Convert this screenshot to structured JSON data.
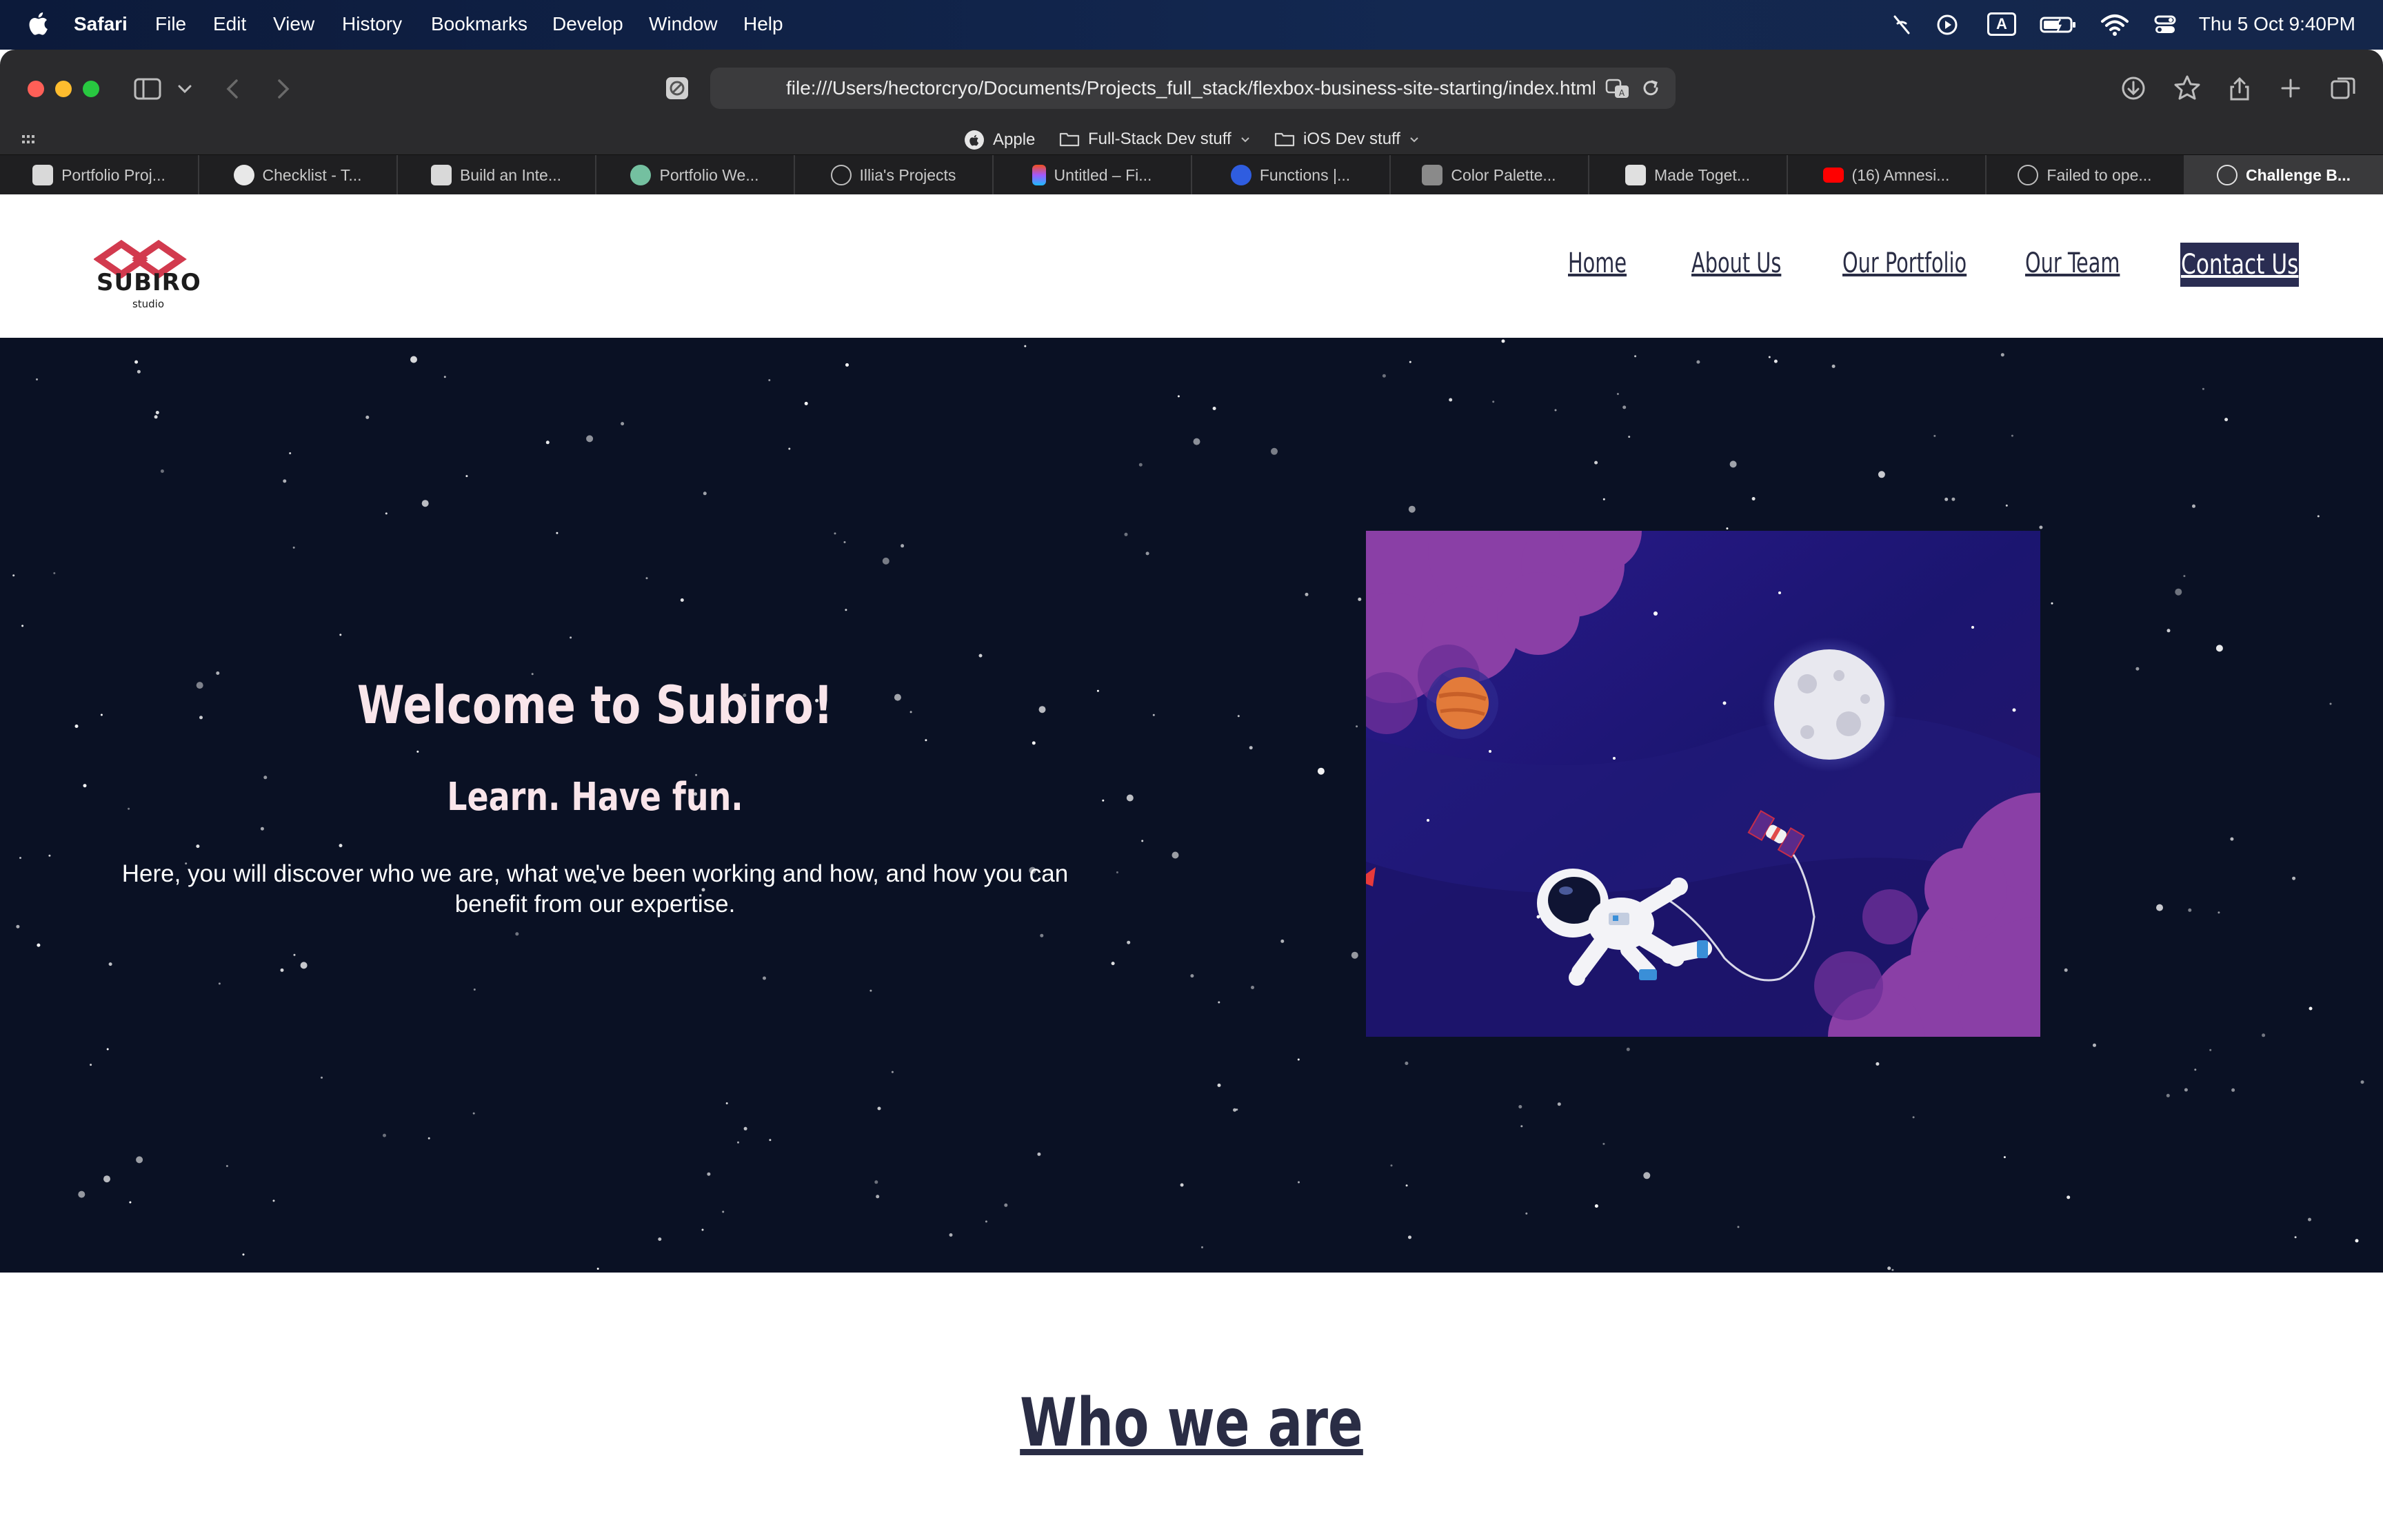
{
  "menubar": {
    "app_name": "Safari",
    "menus": [
      "File",
      "Edit",
      "View",
      "History",
      "Bookmarks",
      "Develop",
      "Window",
      "Help"
    ],
    "status_icons": [
      "wifi-off-icon",
      "play-circle-icon",
      "input-source-a-icon",
      "battery-charging-icon",
      "wifi-icon",
      "control-center-icon"
    ],
    "input_source_label": "A",
    "clock": "Thu 5 Oct  9:40PM"
  },
  "browser": {
    "url": "file:///Users/hectorcryo/Documents/Projects_full_stack/flexbox-business-site-starting/index.html",
    "favorites": [
      {
        "label": "Apple",
        "icon": "apple-icon"
      },
      {
        "label": "Full-Stack Dev stuff",
        "icon": "folder-icon"
      },
      {
        "label": "iOS Dev stuff",
        "icon": "folder-icon"
      }
    ],
    "tabs": [
      {
        "label": "Portfolio Proj...",
        "icon_color": "#d9d9d9",
        "active": false
      },
      {
        "label": "Checklist - T...",
        "icon_color": "#e8e8e8",
        "active": false
      },
      {
        "label": "Build an Inte...",
        "icon_color": "#d9d9d9",
        "active": false
      },
      {
        "label": "Portfolio We...",
        "icon_color": "#74c0a0",
        "active": false
      },
      {
        "label": "Illia's Projects",
        "icon_color": "#bdbdbd",
        "active": false
      },
      {
        "label": "Untitled – Fi...",
        "icon_color": "#f24e1e",
        "active": false
      },
      {
        "label": "Functions |...",
        "icon_color": "#2f5de0",
        "active": false
      },
      {
        "label": "Color Palette...",
        "icon_color": "#8a8a8a",
        "active": false
      },
      {
        "label": "Made Toget...",
        "icon_color": "#e0e0e0",
        "active": false
      },
      {
        "label": "(16) Amnesi...",
        "icon_color": "#ff0000",
        "active": false
      },
      {
        "label": "Failed to ope...",
        "icon_color": "#bdbdbd",
        "active": false
      },
      {
        "label": "Challenge B...",
        "icon_color": "#bdbdbd",
        "active": true
      }
    ]
  },
  "site": {
    "logo": {
      "name": "SUBIRO",
      "tagline": "studio"
    },
    "nav": {
      "home": "Home",
      "about": "About Us",
      "portfolio": "Our Portfolio",
      "team": "Our Team",
      "contact": "Contact Us"
    },
    "hero": {
      "title": "Welcome to Subiro!",
      "subtitle": "Learn. Have fun.",
      "text": "Here, you will discover who we are, what we've been working and how, and how you can benefit from our expertise."
    },
    "section_title": "Who we are",
    "colors": {
      "navy": "#2a2d52",
      "hero_bg": "#0a1124",
      "hero_text": "#f9e5ea",
      "logo_red": "#d23a4e"
    }
  }
}
